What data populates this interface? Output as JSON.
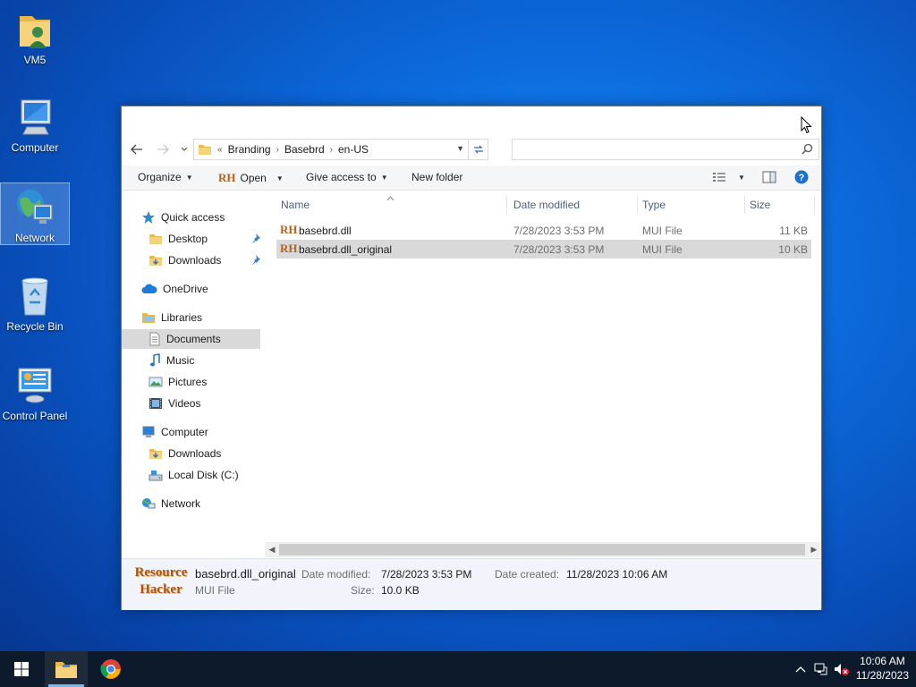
{
  "desktop": {
    "icons": [
      {
        "label": "VM5"
      },
      {
        "label": "Computer"
      },
      {
        "label": "Network"
      },
      {
        "label": "Recycle Bin"
      },
      {
        "label": "Control Panel"
      }
    ]
  },
  "explorer": {
    "breadcrumb": {
      "overflow": "«",
      "items": [
        "Branding",
        "Basebrd",
        "en-US"
      ]
    },
    "search": {
      "value": "",
      "placeholder": ""
    },
    "toolbar": {
      "organize": "Organize",
      "open": "Open",
      "give_access": "Give access to",
      "new_folder": "New folder"
    },
    "nav": {
      "quick_access": "Quick access",
      "desktop": "Desktop",
      "downloads": "Downloads",
      "onedrive": "OneDrive",
      "libraries": "Libraries",
      "documents": "Documents",
      "music": "Music",
      "pictures": "Pictures",
      "videos": "Videos",
      "computer": "Computer",
      "computer_downloads": "Downloads",
      "local_disk": "Local Disk (C:)",
      "network": "Network"
    },
    "columns": {
      "name": "Name",
      "date": "Date modified",
      "type": "Type",
      "size": "Size"
    },
    "files": [
      {
        "name": "basebrd.dll",
        "date": "7/28/2023 3:53 PM",
        "type": "MUI File",
        "size": "11 KB"
      },
      {
        "name": "basebrd.dll_original",
        "date": "7/28/2023 3:53 PM",
        "type": "MUI File",
        "size": "10 KB"
      }
    ],
    "details": {
      "logo_line1": "Resource",
      "logo_line2": "Hacker",
      "file_name": "basebrd.dll_original",
      "file_type": "MUI File",
      "modified_label": "Date modified:",
      "modified_value": "7/28/2023 3:53 PM",
      "created_label": "Date created:",
      "created_value": "11/28/2023 10:06 AM",
      "size_label": "Size:",
      "size_value": "10.0 KB"
    }
  },
  "taskbar": {
    "time": "10:06 AM",
    "date": "11/28/2023"
  }
}
